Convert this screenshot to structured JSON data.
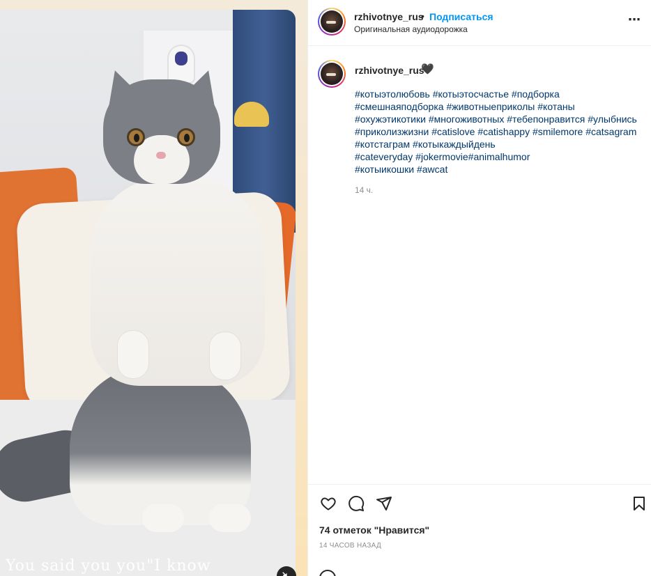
{
  "media": {
    "overlay_text": "You said you you\"I know",
    "mute_icon": "muted-speaker-icon"
  },
  "header": {
    "username": "rzhivotnye_rus",
    "separator": "•",
    "follow_label": "Подписаться",
    "audio_label": "Оригинальная аудиодорожка",
    "more_icon": "⋯"
  },
  "caption": {
    "username": "rzhivotnye_rus",
    "heart": "🖤",
    "tag_lines": [
      [
        "#котыэтолюбовь",
        "#котыэтосчастье",
        "#подборка"
      ],
      [
        "#смешнаяподборка",
        "#животныеприколы",
        "#котаны"
      ],
      [
        "#охужэтикотики",
        "#многоживотных",
        "#тебепонравится",
        "#улыбнись"
      ],
      [
        "#приколизжизни",
        "#catislove",
        "#catishappy",
        "#smilemore",
        "#catsagram"
      ],
      [
        "#котстаграм",
        "#котыкаждыйдень"
      ],
      [
        "#cateveryday",
        "#jokermovie",
        "#animalhumor"
      ],
      [
        "#котыикошки",
        "#awcat"
      ]
    ],
    "time": "14 ч."
  },
  "actions": {
    "likes": "74 отметок \"Нравится\"",
    "posted_ago": "14 ЧАСОВ НАЗАД"
  },
  "colors": {
    "link": "#00376b",
    "follow": "#0095f6",
    "muted": "#8e8e8e"
  }
}
